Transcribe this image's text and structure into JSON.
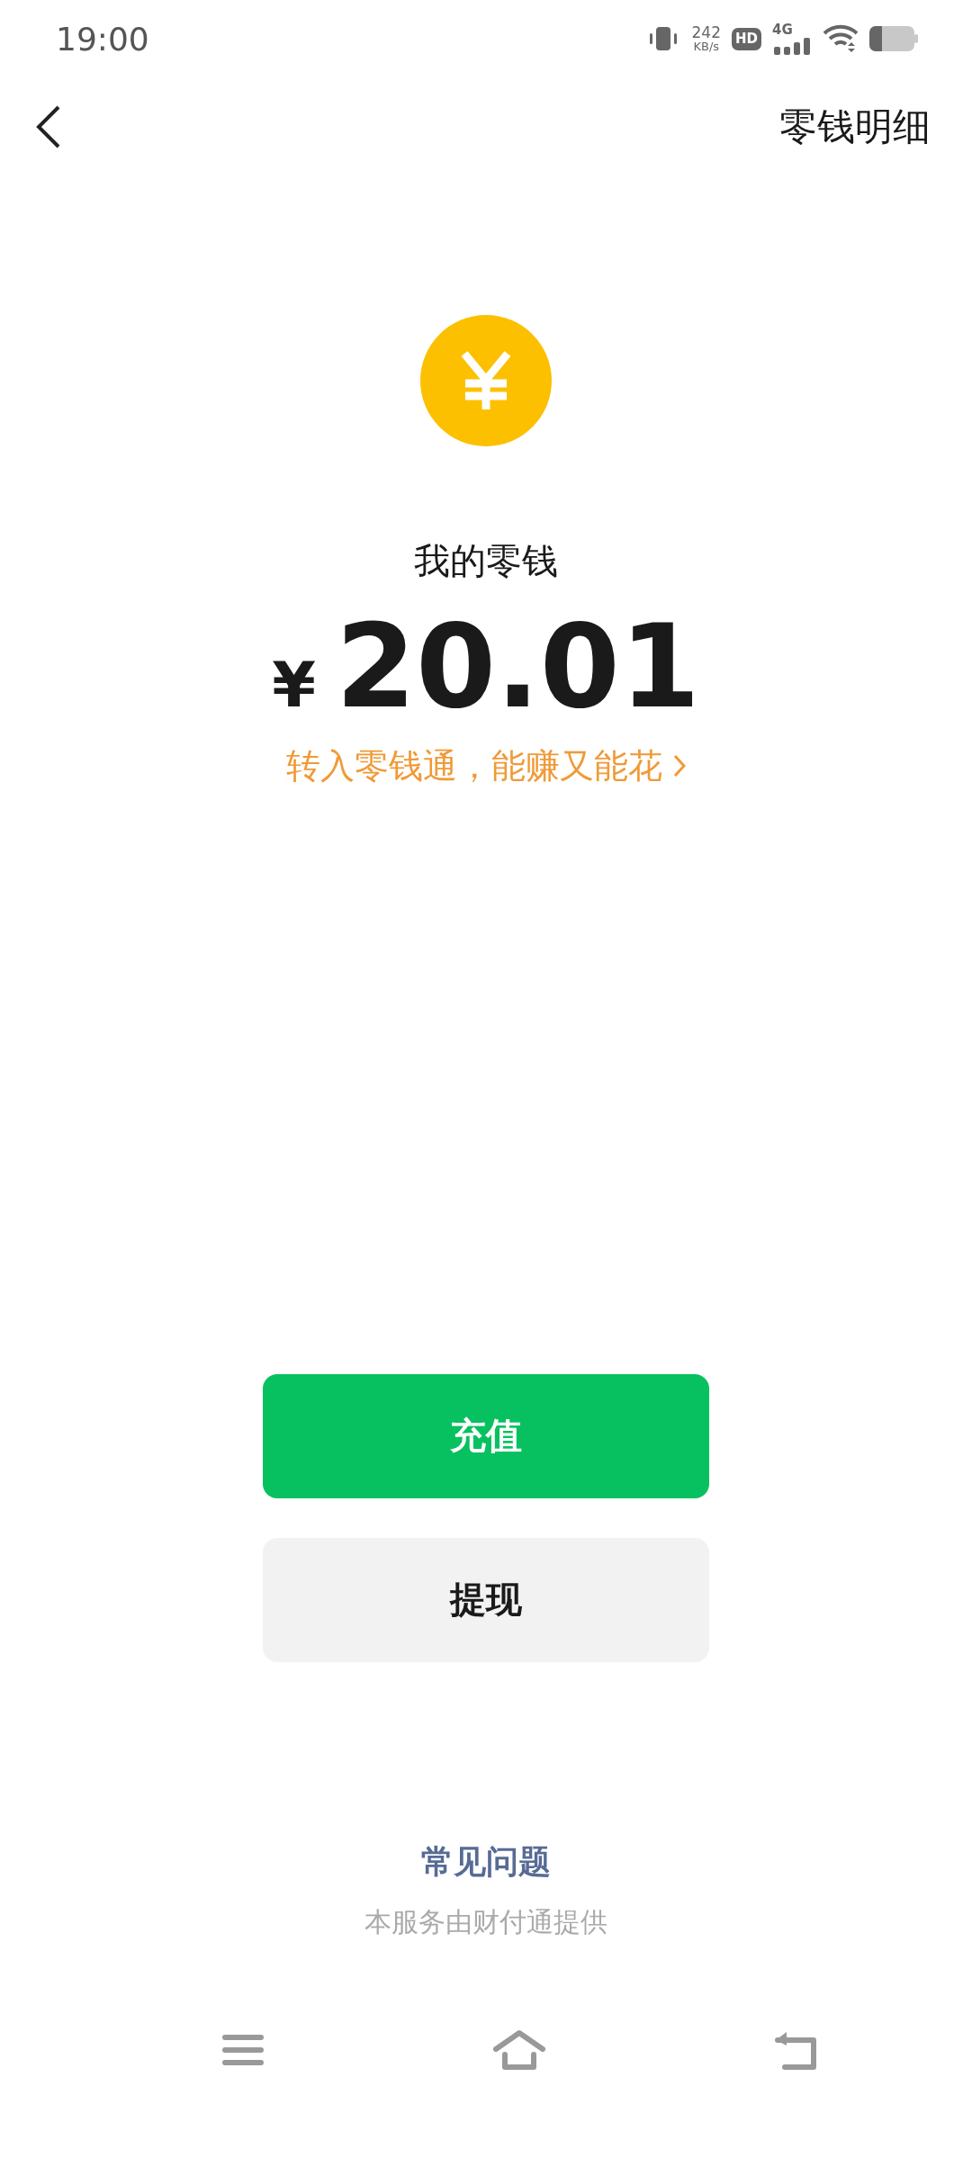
{
  "status_bar": {
    "time": "19:00",
    "speed_value": "242",
    "speed_unit": "KB/s",
    "hd_badge": "HD",
    "network": "4G"
  },
  "header": {
    "title": "零钱明细"
  },
  "balance": {
    "label": "我的零钱",
    "currency": "¥",
    "amount": "20.01",
    "promo_link": "转入零钱通，能赚又能花"
  },
  "buttons": [
    {
      "label": "充值",
      "kind": "primary"
    },
    {
      "label": "提现",
      "kind": "secondary"
    }
  ],
  "footer": {
    "faq_link": "常见问题",
    "provider_note": "本服务由财付通提供"
  }
}
